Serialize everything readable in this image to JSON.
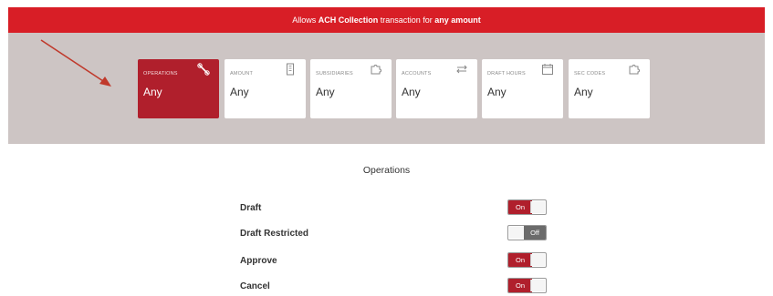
{
  "banner": {
    "prefix": "Allows ",
    "type": "ACH Collection",
    "middle": " transaction for ",
    "amount": "any amount"
  },
  "cards": [
    {
      "label": "OPERATIONS",
      "value": "Any",
      "icon": "wrench-icon"
    },
    {
      "label": "AMOUNT",
      "value": "Any",
      "icon": "building-icon"
    },
    {
      "label": "SUBSIDIARIES",
      "value": "Any",
      "icon": "puzzle-icon"
    },
    {
      "label": "ACCOUNTS",
      "value": "Any",
      "icon": "transfer-arrows-icon"
    },
    {
      "label": "DRAFT HOURS",
      "value": "Any",
      "icon": "calendar-icon"
    },
    {
      "label": "SEC CODES",
      "value": "Any",
      "icon": "puzzle-icon"
    }
  ],
  "section": {
    "title": "Operations"
  },
  "operations": [
    {
      "name": "Draft",
      "state": "On"
    },
    {
      "name": "Draft Restricted",
      "state": "Off"
    },
    {
      "name": "Approve",
      "state": "On"
    },
    {
      "name": "Cancel",
      "state": "On"
    }
  ],
  "colors": {
    "accent": "#d81e26",
    "active_card": "#b01f2c",
    "panel": "#cdc5c4"
  }
}
